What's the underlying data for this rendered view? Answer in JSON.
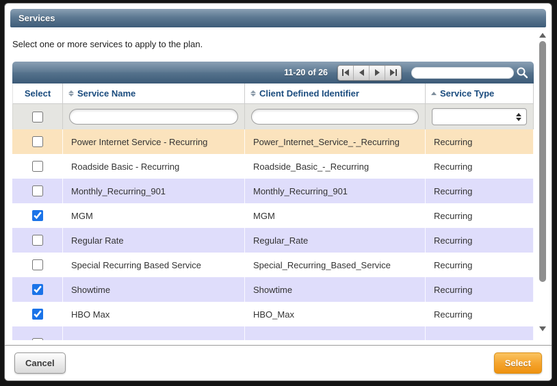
{
  "modal": {
    "title": "Services",
    "instruction": "Select one or more services to apply to the plan."
  },
  "toolbar": {
    "pagination_text": "11-20 of 26",
    "pager_icons": [
      "first-page",
      "previous-page",
      "next-page",
      "last-page"
    ],
    "search": {
      "value": "",
      "placeholder": ""
    },
    "search_icon": "magnifier"
  },
  "table": {
    "columns": [
      {
        "label": "Select",
        "sort": "none"
      },
      {
        "label": "Service Name",
        "sort": "unsorted"
      },
      {
        "label": "Client Defined Identifier",
        "sort": "unsorted"
      },
      {
        "label": "Service Type",
        "sort": "asc"
      }
    ],
    "filters": {
      "select_all_checked": false,
      "service_name_value": "",
      "client_defined_identifier_value": "",
      "service_type_value": ""
    },
    "rows": [
      {
        "checked": false,
        "service_name": "Power Internet Service - Recurring",
        "identifier": "Power_Internet_Service_-_Recurring",
        "service_type": "Recurring",
        "bg": "highlight"
      },
      {
        "checked": false,
        "service_name": "Roadside Basic - Recurring",
        "identifier": "Roadside_Basic_-_Recurring",
        "service_type": "Recurring",
        "bg": "white"
      },
      {
        "checked": false,
        "service_name": "Monthly_Recurring_901",
        "identifier": "Monthly_Recurring_901",
        "service_type": "Recurring",
        "bg": "alt"
      },
      {
        "checked": true,
        "service_name": "MGM",
        "identifier": "MGM",
        "service_type": "Recurring",
        "bg": "white"
      },
      {
        "checked": false,
        "service_name": "Regular Rate",
        "identifier": "Regular_Rate",
        "service_type": "Recurring",
        "bg": "alt"
      },
      {
        "checked": false,
        "service_name": "Special Recurring Based Service",
        "identifier": "Special_Recurring_Based_Service",
        "service_type": "Recurring",
        "bg": "white"
      },
      {
        "checked": true,
        "service_name": "Showtime",
        "identifier": "Showtime",
        "service_type": "Recurring",
        "bg": "alt"
      },
      {
        "checked": true,
        "service_name": "HBO Max",
        "identifier": "HBO_Max",
        "service_type": "Recurring",
        "bg": "white"
      }
    ],
    "partial_row": {
      "visible": true,
      "bg": "alt"
    }
  },
  "footer": {
    "cancel_label": "Cancel",
    "select_label": "Select"
  },
  "colors": {
    "titlebar_gradient_top": "#8aa0b4",
    "titlebar_gradient_bottom": "#3e5c79",
    "header_text_blue": "#1b4c7e",
    "row_highlight_orange": "#fbe3bd",
    "row_alt_lavender": "#dfddfb",
    "filter_row_gray": "#e5e5e1",
    "checkbox_checked_blue": "#1a73e8",
    "select_button_orange": "#f5a52f"
  }
}
